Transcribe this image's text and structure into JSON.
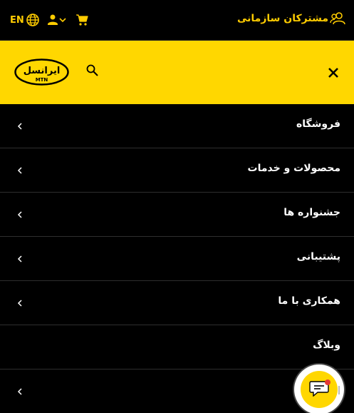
{
  "topbar": {
    "org_label": "مشترکان سازمانی",
    "lang_label": "EN"
  },
  "header": {
    "logo_text": "ایرانسل",
    "logo_sub": "MTN"
  },
  "menu": {
    "items": [
      {
        "label": "فروشگاه"
      },
      {
        "label": "محصولات و خدمات"
      },
      {
        "label": "جشنواره ها"
      },
      {
        "label": "پشتیبانی"
      },
      {
        "label": "همکاری با ما"
      },
      {
        "label": "وبلاگ"
      },
      {
        "label": ""
      }
    ]
  },
  "colors": {
    "brand_yellow": "#ffd700",
    "background": "#000000",
    "accent_text": "#ffcc00"
  },
  "icons": {
    "org": "users-icon",
    "lang": "globe-icon",
    "user": "user-icon",
    "cart": "cart-icon",
    "search": "search-icon",
    "close": "close-icon",
    "chevron": "chevron-left-icon",
    "chat": "chat-icon"
  }
}
